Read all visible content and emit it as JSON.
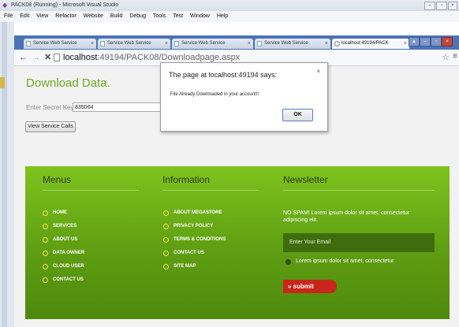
{
  "vs": {
    "title": "PACK08 (Running) - Microsoft Visual Studio",
    "menu": [
      "File",
      "Edit",
      "View",
      "Refactor",
      "Website",
      "Build",
      "Debug",
      "Tools",
      "Test",
      "Window",
      "Help"
    ]
  },
  "browser": {
    "tabs": [
      "Service Web Service",
      "Service Web Service",
      "Service Web Service",
      "Service Web Service",
      "localhost:49194/PACK"
    ],
    "url_host": "localhost",
    "url_path": ":49194/PACK08/Downloadpage.aspx"
  },
  "page": {
    "title": "Download Data.",
    "secret_key_label": "Enter Secret Key",
    "secret_key_value": "835064",
    "view_calls_button": "View Service Calls"
  },
  "footer": {
    "menus": {
      "heading": "Menus",
      "items": [
        "HOME",
        "SERVICES",
        "ABOUT US",
        "DATA OWNER",
        "CLOUD USER",
        "CONTACT US"
      ]
    },
    "information": {
      "heading": "Information",
      "items": [
        "ABOUT MEGASTORE",
        "PRIVACY POLICY",
        "TERMS & CONDITIONS",
        "CONTACT US",
        "SITE MAP"
      ]
    },
    "newsletter": {
      "heading": "Newsletter",
      "text": "NO SPAM! Lorem ipsum dolor sit amet, consectetur adipiscing elit.",
      "email_placeholder": "Enter Your Email",
      "checkbox_label": "Lorem ipsum dolor sit amet, consectetur",
      "submit_label": "» submit"
    }
  },
  "dialog": {
    "title": "The page at localhost:49194 says:",
    "message": "File Already Downloaded in your account!!",
    "ok_label": "OK",
    "close_glyph": "×"
  },
  "icons": {
    "back": "←",
    "forward": "→",
    "stop": "✕",
    "star": "☆",
    "menu": "≡"
  }
}
